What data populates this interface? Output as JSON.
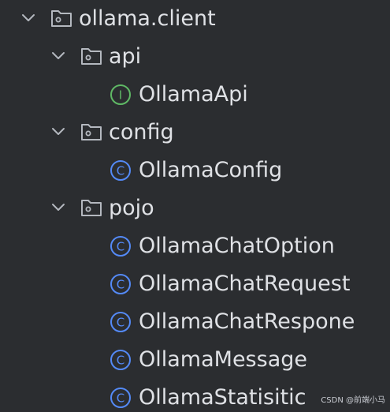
{
  "tree": {
    "root": {
      "label": "ollama.client",
      "icon": "folder-icon",
      "expanded": true
    },
    "api": {
      "label": "api",
      "icon": "folder-icon",
      "expanded": true
    },
    "api_items": [
      {
        "label": "OllamaApi",
        "icon": "interface-icon",
        "icon_letter": "I",
        "icon_color": "#5fb865"
      }
    ],
    "config": {
      "label": "config",
      "icon": "folder-icon",
      "expanded": true
    },
    "config_items": [
      {
        "label": "OllamaConfig",
        "icon": "class-icon",
        "icon_letter": "C",
        "icon_color": "#548af7"
      }
    ],
    "pojo": {
      "label": "pojo",
      "icon": "folder-icon",
      "expanded": true
    },
    "pojo_items": [
      {
        "label": "OllamaChatOption",
        "icon": "class-icon",
        "icon_letter": "C",
        "icon_color": "#548af7"
      },
      {
        "label": "OllamaChatRequest",
        "icon": "class-icon",
        "icon_letter": "C",
        "icon_color": "#548af7"
      },
      {
        "label": "OllamaChatRespone",
        "icon": "class-icon",
        "icon_letter": "C",
        "icon_color": "#548af7"
      },
      {
        "label": "OllamaMessage",
        "icon": "class-icon",
        "icon_letter": "C",
        "icon_color": "#548af7"
      },
      {
        "label": "OllamaStatisitic",
        "icon": "class-icon",
        "icon_letter": "C",
        "icon_color": "#548af7"
      }
    ]
  },
  "watermark": "CSDN @前端小马",
  "colors": {
    "background": "#2b2d30",
    "text": "#dfe1e5",
    "chevron": "#b4b8bf",
    "folder_stroke": "#b4b8bf"
  }
}
